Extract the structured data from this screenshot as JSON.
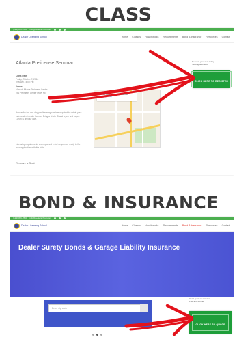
{
  "section1": {
    "heading": "CLASS",
    "topbar": {
      "phone": "(123) 456-7890",
      "email": "info@dealerschool.com"
    },
    "logo_text": "Dealer Licensing School",
    "nav": [
      "Home",
      "Classes",
      "How it works",
      "Requirements",
      "Bond & Insurance",
      "Resources",
      "Contact"
    ],
    "active_nav": "",
    "page_title": "Atlanta Prelicense Seminar",
    "details": [
      "Class Date:",
      "Friday, October 7, 2016",
      "9:00 AM - 4:00 PM",
      "Venue:",
      "Marriott Atlanta Perimeter Center",
      "246 Perimeter Center Pkwy NE"
    ],
    "body": [
      "Join us for the one-day pre-licensing seminar required to obtain your",
      "independent dealer license. Bring a photo ID and a pen and paper.",
      "Lunch is on your own.",
      "",
      "Licensing requirements are explained in full so you are ready to file",
      "your application with the state."
    ],
    "footer_link": "Reserve a Seat",
    "map_card": [
      "Marriott Atlanta Perimeter Center",
      "View larger map"
    ],
    "sidebar_note": [
      "Reserve your seat today.",
      "Seating is limited."
    ],
    "cta_label": "CLICK HERE TO REGISTER"
  },
  "section2": {
    "heading": "BOND & INSURANCE",
    "topbar": {
      "phone": "(123) 456-7890",
      "email": "info@dealerschool.com"
    },
    "logo_text": "Dealer Licensing School",
    "nav": [
      "Home",
      "Classes",
      "How it works",
      "Requirements",
      "Bond & Insurance",
      "Resources",
      "Contact"
    ],
    "active_nav": "Bond & Insurance",
    "hero_title": "Dealer Surety Bonds & Garage Liability Insurance",
    "search_placeholder": "Enter zip code",
    "sidebar_note": [
      "Get a quote in minutes.",
      "Fast and simple."
    ],
    "cta_label": "CLICK HERE TO QUOTE"
  },
  "colors": {
    "topbar": "#4caf50",
    "nav_brand": "#3d4a9b",
    "hero": "#4a4fcf",
    "cta_green": "#1e9e3a",
    "arrow_red": "#e3121b"
  },
  "icons": {
    "arrow": "red-hand-drawn-arrow-icon",
    "map_pin": "map-pin-icon",
    "search": "search-icon"
  }
}
